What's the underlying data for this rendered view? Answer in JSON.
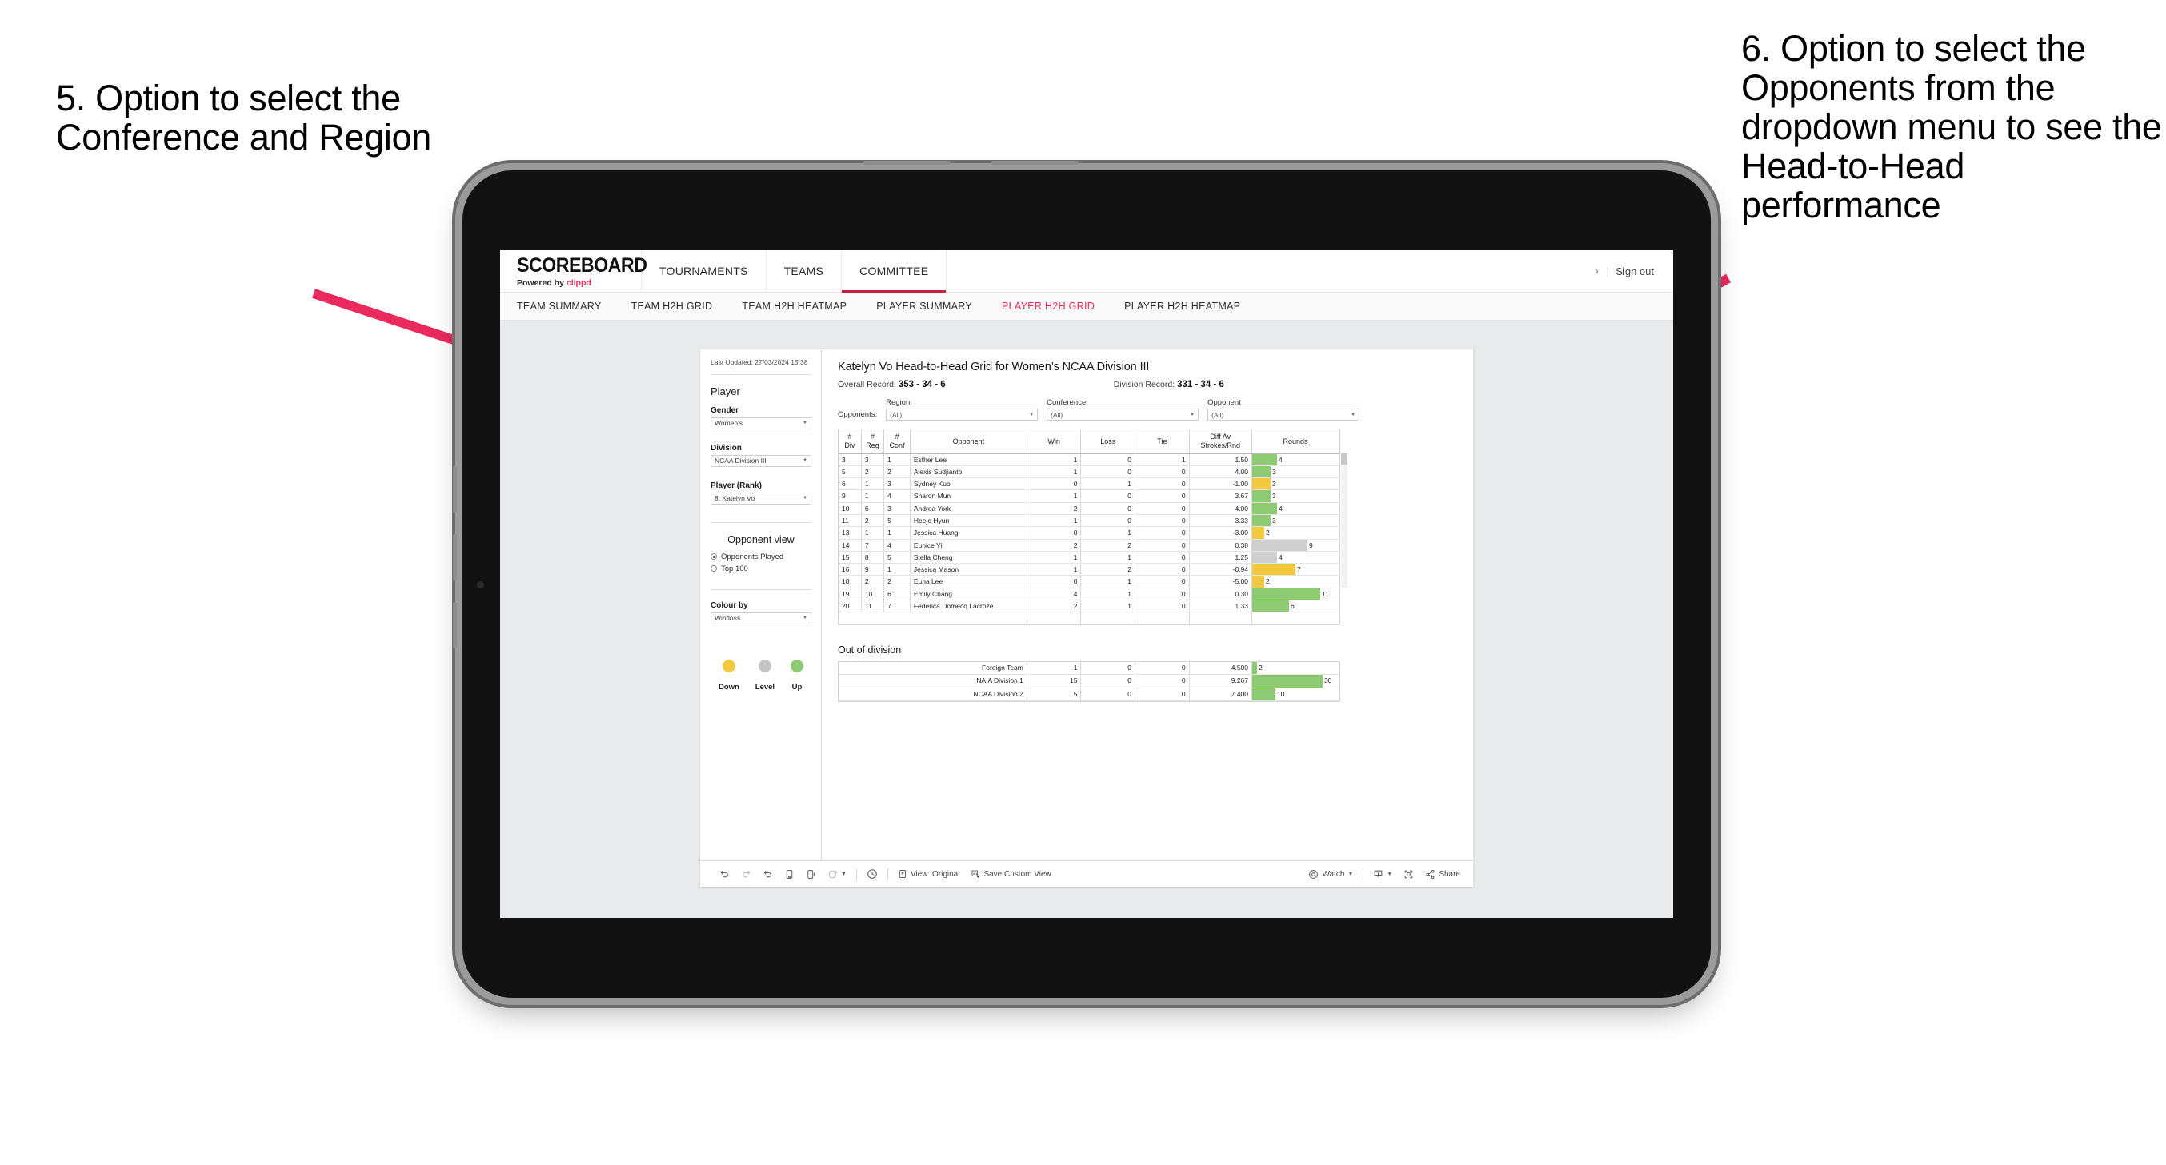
{
  "annotations": {
    "left": "5. Option to select the Conference and Region",
    "right": "6. Option to select the Opponents from the dropdown menu to see the Head-to-Head performance"
  },
  "app": {
    "brand": {
      "name": "SCOREBOARD",
      "sub_prefix": "Powered by ",
      "sub_brand": "clippd"
    },
    "nav": [
      {
        "label": "TOURNAMENTS",
        "active": false
      },
      {
        "label": "TEAMS",
        "active": false
      },
      {
        "label": "COMMITTEE",
        "active": true
      }
    ],
    "top_right": {
      "chevron": "›",
      "separator": "|",
      "sign_out": "Sign out"
    },
    "subnav": [
      {
        "label": "TEAM SUMMARY",
        "active": false
      },
      {
        "label": "TEAM H2H GRID",
        "active": false
      },
      {
        "label": "TEAM H2H HEATMAP",
        "active": false
      },
      {
        "label": "PLAYER SUMMARY",
        "active": false
      },
      {
        "label": "PLAYER H2H GRID",
        "active": true
      },
      {
        "label": "PLAYER H2H HEATMAP",
        "active": false
      }
    ]
  },
  "sidebar": {
    "last_updated": "Last Updated: 27/03/2024 15:38",
    "section_player": "Player",
    "gender": {
      "label": "Gender",
      "value": "Women's"
    },
    "division": {
      "label": "Division",
      "value": "NCAA Division III"
    },
    "player_rank": {
      "label": "Player (Rank)",
      "value": "8. Katelyn Vo"
    },
    "opponent_view": {
      "title": "Opponent view",
      "options": [
        {
          "label": "Opponents Played",
          "selected": true
        },
        {
          "label": "Top 100",
          "selected": false
        }
      ]
    },
    "colour_by": {
      "label": "Colour by",
      "value": "Win/loss"
    },
    "legend": [
      {
        "label": "Down",
        "color": "#f2ca40"
      },
      {
        "label": "Level",
        "color": "#c4c4c4"
      },
      {
        "label": "Up",
        "color": "#8ec973"
      }
    ]
  },
  "viz": {
    "title": "Katelyn Vo Head-to-Head Grid for Women’s NCAA Division III",
    "overall_record_label": "Overall Record:",
    "overall_record_value": "353 -  34 - 6",
    "division_record_label": "Division Record:",
    "division_record_value": "331 -  34 - 6",
    "opponents_label": "Opponents:",
    "filters": [
      {
        "label": "Region",
        "value": "(All)"
      },
      {
        "label": "Conference",
        "value": "(All)"
      },
      {
        "label": "Opponent",
        "value": "(All)"
      }
    ],
    "out_of_division_title": "Out of division"
  },
  "toolbar": {
    "view_original": "View: Original",
    "save_custom_view": "Save Custom View",
    "watch": "Watch",
    "share": "Share"
  },
  "chart_data": {
    "type": "table",
    "title": "Katelyn Vo Head-to-Head Grid for Women’s NCAA Division III",
    "columns": [
      "# Div",
      "# Reg",
      "# Conf",
      "Opponent",
      "Win",
      "Loss",
      "Tie",
      "Diff Av Strokes/Rnd",
      "Rounds"
    ],
    "column_headers_two_line": [
      {
        "l1": "#",
        "l2": "Div"
      },
      {
        "l1": "#",
        "l2": "Reg"
      },
      {
        "l1": "#",
        "l2": "Conf"
      },
      {
        "l1": "Opponent",
        "l2": ""
      },
      {
        "l1": "Win",
        "l2": ""
      },
      {
        "l1": "Loss",
        "l2": ""
      },
      {
        "l1": "Tie",
        "l2": ""
      },
      {
        "l1": "Diff Av",
        "l2": "Strokes/Rnd"
      },
      {
        "l1": "Rounds",
        "l2": ""
      }
    ],
    "rounds_max": 13,
    "rows": [
      {
        "div": "3",
        "reg": "3",
        "conf": "1",
        "opponent": "Esther Lee",
        "win": "1",
        "loss": "0",
        "tie": "1",
        "diff": "1.50",
        "rounds": "4",
        "rounds_n": 4,
        "color": "green",
        "diff_color": "green"
      },
      {
        "div": "5",
        "reg": "2",
        "conf": "2",
        "opponent": "Alexis Sudjianto",
        "win": "1",
        "loss": "0",
        "tie": "0",
        "diff": "4.00",
        "rounds": "3",
        "rounds_n": 3,
        "color": "green",
        "diff_color": "green"
      },
      {
        "div": "6",
        "reg": "1",
        "conf": "3",
        "opponent": "Sydney Kuo",
        "win": "0",
        "loss": "1",
        "tie": "0",
        "diff": "-1.00",
        "rounds": "3",
        "rounds_n": 3,
        "color": "yellow",
        "diff_color": "yellow"
      },
      {
        "div": "9",
        "reg": "1",
        "conf": "4",
        "opponent": "Sharon Mun",
        "win": "1",
        "loss": "0",
        "tie": "0",
        "diff": "3.67",
        "rounds": "3",
        "rounds_n": 3,
        "color": "green",
        "diff_color": "green"
      },
      {
        "div": "10",
        "reg": "6",
        "conf": "3",
        "opponent": "Andrea York",
        "win": "2",
        "loss": "0",
        "tie": "0",
        "diff": "4.00",
        "rounds": "4",
        "rounds_n": 4,
        "color": "green",
        "diff_color": "green"
      },
      {
        "div": "11",
        "reg": "2",
        "conf": "5",
        "opponent": "Heejo Hyun",
        "win": "1",
        "loss": "0",
        "tie": "0",
        "diff": "3.33",
        "rounds": "3",
        "rounds_n": 3,
        "color": "green",
        "diff_color": "green"
      },
      {
        "div": "13",
        "reg": "1",
        "conf": "1",
        "opponent": "Jessica Huang",
        "win": "0",
        "loss": "1",
        "tie": "0",
        "diff": "-3.00",
        "rounds": "2",
        "rounds_n": 2,
        "color": "yellow",
        "diff_color": "yellow"
      },
      {
        "div": "14",
        "reg": "7",
        "conf": "4",
        "opponent": "Eunice Yi",
        "win": "2",
        "loss": "2",
        "tie": "0",
        "diff": "0.38",
        "rounds": "9",
        "rounds_n": 9,
        "color": "grey",
        "diff_color": "green"
      },
      {
        "div": "15",
        "reg": "8",
        "conf": "5",
        "opponent": "Stella Cheng",
        "win": "1",
        "loss": "1",
        "tie": "0",
        "diff": "1.25",
        "rounds": "4",
        "rounds_n": 4,
        "color": "grey",
        "diff_color": "green"
      },
      {
        "div": "16",
        "reg": "9",
        "conf": "1",
        "opponent": "Jessica Mason",
        "win": "1",
        "loss": "2",
        "tie": "0",
        "diff": "-0.94",
        "rounds": "7",
        "rounds_n": 7,
        "color": "yellow",
        "diff_color": "yellow"
      },
      {
        "div": "18",
        "reg": "2",
        "conf": "2",
        "opponent": "Euna Lee",
        "win": "0",
        "loss": "1",
        "tie": "0",
        "diff": "-5.00",
        "rounds": "2",
        "rounds_n": 2,
        "color": "yellow",
        "diff_color": "yellow"
      },
      {
        "div": "19",
        "reg": "10",
        "conf": "6",
        "opponent": "Emily Chang",
        "win": "4",
        "loss": "1",
        "tie": "0",
        "diff": "0.30",
        "rounds": "11",
        "rounds_n": 11,
        "color": "green",
        "diff_color": "green"
      },
      {
        "div": "20",
        "reg": "11",
        "conf": "7",
        "opponent": "Federica Domecq Lacroze",
        "win": "2",
        "loss": "1",
        "tie": "0",
        "diff": "1.33",
        "rounds": "6",
        "rounds_n": 6,
        "color": "green",
        "diff_color": "green"
      }
    ],
    "out_of_division": {
      "rounds_max": 34,
      "rows": [
        {
          "name": "Foreign Team",
          "win": "1",
          "loss": "0",
          "tie": "0",
          "diff": "4.500",
          "rounds": "2",
          "rounds_n": 2,
          "color": "green"
        },
        {
          "name": "NAIA Division 1",
          "win": "15",
          "loss": "0",
          "tie": "0",
          "diff": "9.267",
          "rounds": "30",
          "rounds_n": 30,
          "color": "green"
        },
        {
          "name": "NCAA Division 2",
          "win": "5",
          "loss": "0",
          "tie": "0",
          "diff": "7.400",
          "rounds": "10",
          "rounds_n": 10,
          "color": "green"
        }
      ]
    }
  }
}
